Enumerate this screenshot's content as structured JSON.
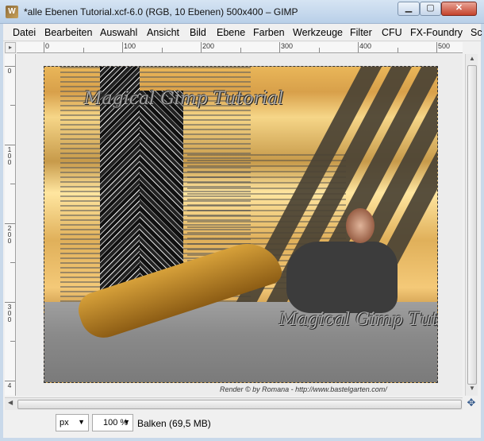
{
  "window": {
    "title": "*alle Ebenen Tutorial.xcf-6.0 (RGB, 10 Ebenen) 500x400 – GIMP",
    "app_icon_letter": "W"
  },
  "menubar": {
    "items": [
      "Datei",
      "Bearbeiten",
      "Auswahl",
      "Ansicht",
      "Bild",
      "Ebene",
      "Farben",
      "Werkzeuge",
      "Filter",
      "CFU",
      "FX-Foundry",
      "Sc"
    ]
  },
  "ruler": {
    "corner_label": "▸",
    "h_labels": [
      "0",
      "100",
      "200",
      "300",
      "400",
      "500"
    ],
    "v_labels": [
      "0",
      "100",
      "200",
      "300",
      "4"
    ]
  },
  "canvas": {
    "watermark_top": "Magical Gimp Tutorial",
    "watermark_bottom": "Magical Gimp Tutorial",
    "credit": "Render © by Romana - http://www.bastelgarten.com/"
  },
  "statusbar": {
    "unit": "px",
    "zoom": "100 %",
    "status": "Balken (69,5 MB)"
  },
  "icons": {
    "nav": "navigate-icon",
    "scroll_up": "scroll-up-icon",
    "scroll_down": "scroll-down-icon",
    "scroll_left": "scroll-left-icon",
    "scroll_right": "scroll-right-icon"
  }
}
